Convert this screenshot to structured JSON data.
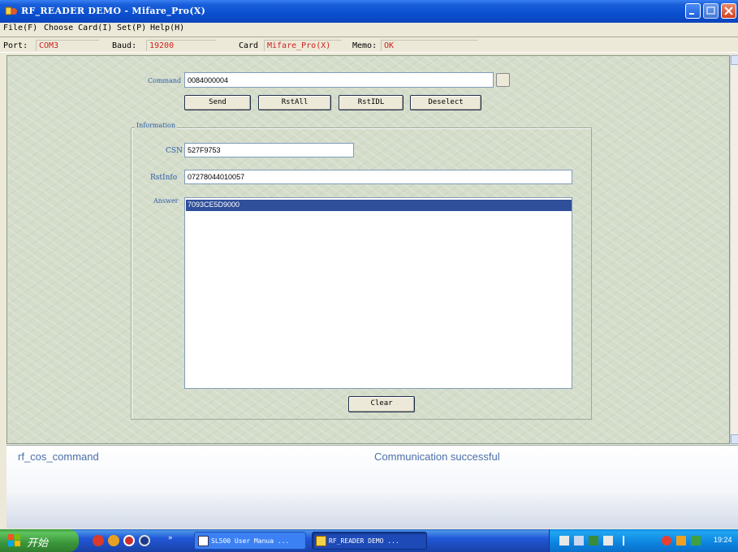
{
  "window": {
    "title": "RF_READER DEMO  -  Mifare_Pro(X)"
  },
  "menu": {
    "items": [
      "File(F)",
      "Choose Card(I)",
      "Set(P)",
      "Help(H)"
    ]
  },
  "infobar": {
    "port_label": "Port:",
    "port_value": "COM3",
    "baud_label": "Baud:",
    "baud_value": "19200",
    "card_label": "Card",
    "card_value": "Mifare_Pro(X)",
    "memo_label": "Memo:",
    "memo_value": "OK"
  },
  "command": {
    "label": "Command",
    "value": "0084000004"
  },
  "buttons": {
    "send": "Send",
    "rstall": "RstAll",
    "rstidl": "RstIDL",
    "deselect": "Deselect",
    "clear": "Clear"
  },
  "information": {
    "title": "Information",
    "csn_label": "CSN",
    "csn_value": "527F9753",
    "rstinfo_label": "RstInfo",
    "rstinfo_value": "07278044010057",
    "answer_label": "Answer",
    "answer_items": [
      "7093CE5D9000"
    ]
  },
  "status": {
    "function": "rf_cos_command",
    "message": "Communication successful"
  },
  "taskbar": {
    "start_label": "开始",
    "tasks": [
      "SL500 User Manua ...",
      "RF_READER DEMO  ..."
    ],
    "clock": "19:24"
  },
  "colors": {
    "accent": "#0a4fd0",
    "value_red": "#cc2222",
    "label_blue": "#2a5ea8",
    "selection": "#2f4f9a"
  }
}
